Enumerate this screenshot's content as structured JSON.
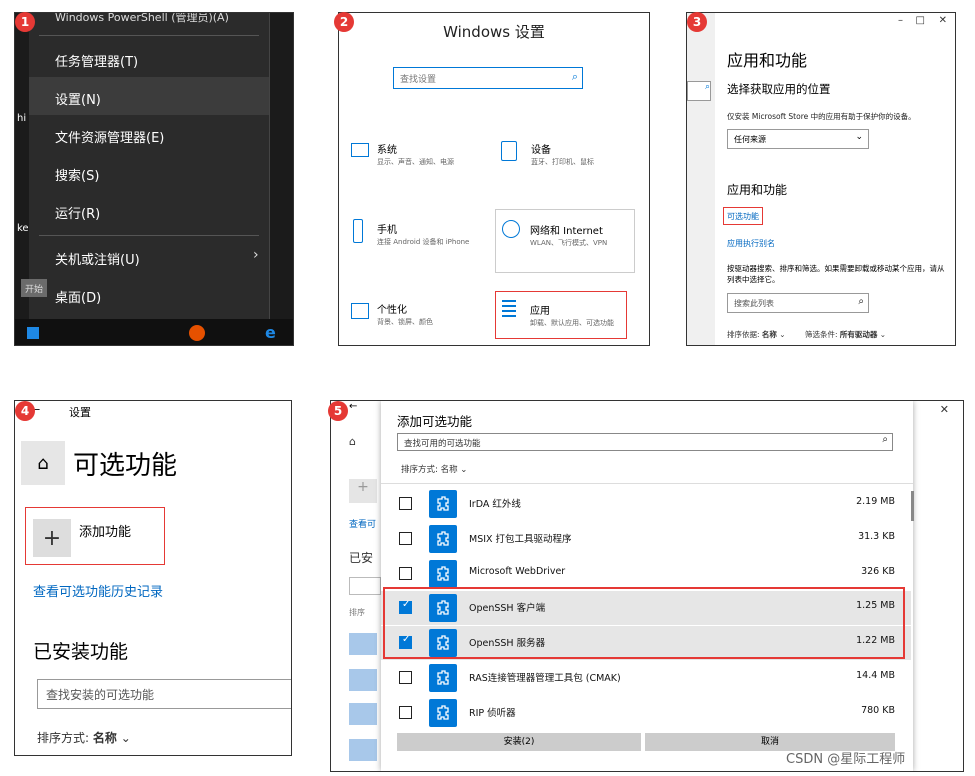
{
  "panel1": {
    "badge": "1",
    "top_cut": "Windows PowerShell (管理员)(A)",
    "items": [
      "任务管理器(T)",
      "设置(N)",
      "文件资源管理器(E)",
      "搜索(S)",
      "运行(R)",
      "关机或注销(U)",
      "桌面(D)"
    ],
    "start_tip": "开始",
    "left_frag1": "hi",
    "left_frag2": "ke"
  },
  "panel2": {
    "badge": "2",
    "title": "Windows 设置",
    "search_placeholder": "查找设置",
    "tiles": [
      {
        "title": "系统",
        "sub": "显示、声音、通知、电源"
      },
      {
        "title": "设备",
        "sub": "蓝牙、打印机、鼠标"
      },
      {
        "title": "手机",
        "sub": "连接 Android 设备和 iPhone"
      },
      {
        "title": "网络和 Internet",
        "sub": "WLAN、飞行模式、VPN"
      },
      {
        "title": "个性化",
        "sub": "背景、锁屏、颜色"
      },
      {
        "title": "应用",
        "sub": "卸载、默认应用、可选功能"
      }
    ]
  },
  "panel3": {
    "badge": "3",
    "title": "应用和功能",
    "section1": "选择获取应用的位置",
    "desc1": "仅安装 Microsoft Store 中的应用有助于保护你的设备。",
    "dropdown": "任何来源",
    "section2": "应用和功能",
    "link1": "可选功能",
    "link2": "应用执行别名",
    "desc2": "按驱动器搜索、排序和筛选。如果需要卸载或移动某个应用，请从列表中选择它。",
    "search_placeholder": "搜索此列表",
    "sort_label": "排序依据:",
    "sort_value": "名称",
    "filter_label": "筛选条件:",
    "filter_value": "所有驱动器",
    "win_min": "–",
    "win_max": "□",
    "win_close": "✕"
  },
  "panel4": {
    "badge": "4",
    "back": "←",
    "header": "设置",
    "title": "可选功能",
    "add_label": "添加功能",
    "history_link": "查看可选功能历史记录",
    "installed_title": "已安装功能",
    "search_placeholder": "查找安装的可选功能",
    "sort_label": "排序方式:",
    "sort_value": "名称"
  },
  "panel5": {
    "badge": "5",
    "dialog_title": "添加可选功能",
    "search_placeholder": "查找可用的可选功能",
    "sort_label": "排序方式:",
    "sort_value": "名称",
    "rows": [
      {
        "name": "IrDA 红外线",
        "size": "2.19 MB",
        "checked": false
      },
      {
        "name": "MSIX 打包工具驱动程序",
        "size": "31.3 KB",
        "checked": false
      },
      {
        "name": "Microsoft WebDriver",
        "size": "326 KB",
        "checked": false
      },
      {
        "name": "OpenSSH 客户端",
        "size": "1.25 MB",
        "checked": true
      },
      {
        "name": "OpenSSH 服务器",
        "size": "1.22 MB",
        "checked": true
      },
      {
        "name": "RAS连接管理器管理工具包 (CMAK)",
        "size": "14.4 MB",
        "checked": false
      },
      {
        "name": "RIP 侦听器",
        "size": "780 KB",
        "checked": false
      }
    ],
    "install_button": "安装(2)",
    "cancel_button": "取消",
    "bg_frag1": "查看可",
    "bg_frag2": "已安",
    "bg_frag3": "排序",
    "win_min": "–",
    "win_max": "□",
    "win_close": "✕"
  },
  "watermark": "CSDN @星际工程师",
  "colors": {
    "accent": "#0078d7",
    "highlight_red": "#e53935"
  }
}
